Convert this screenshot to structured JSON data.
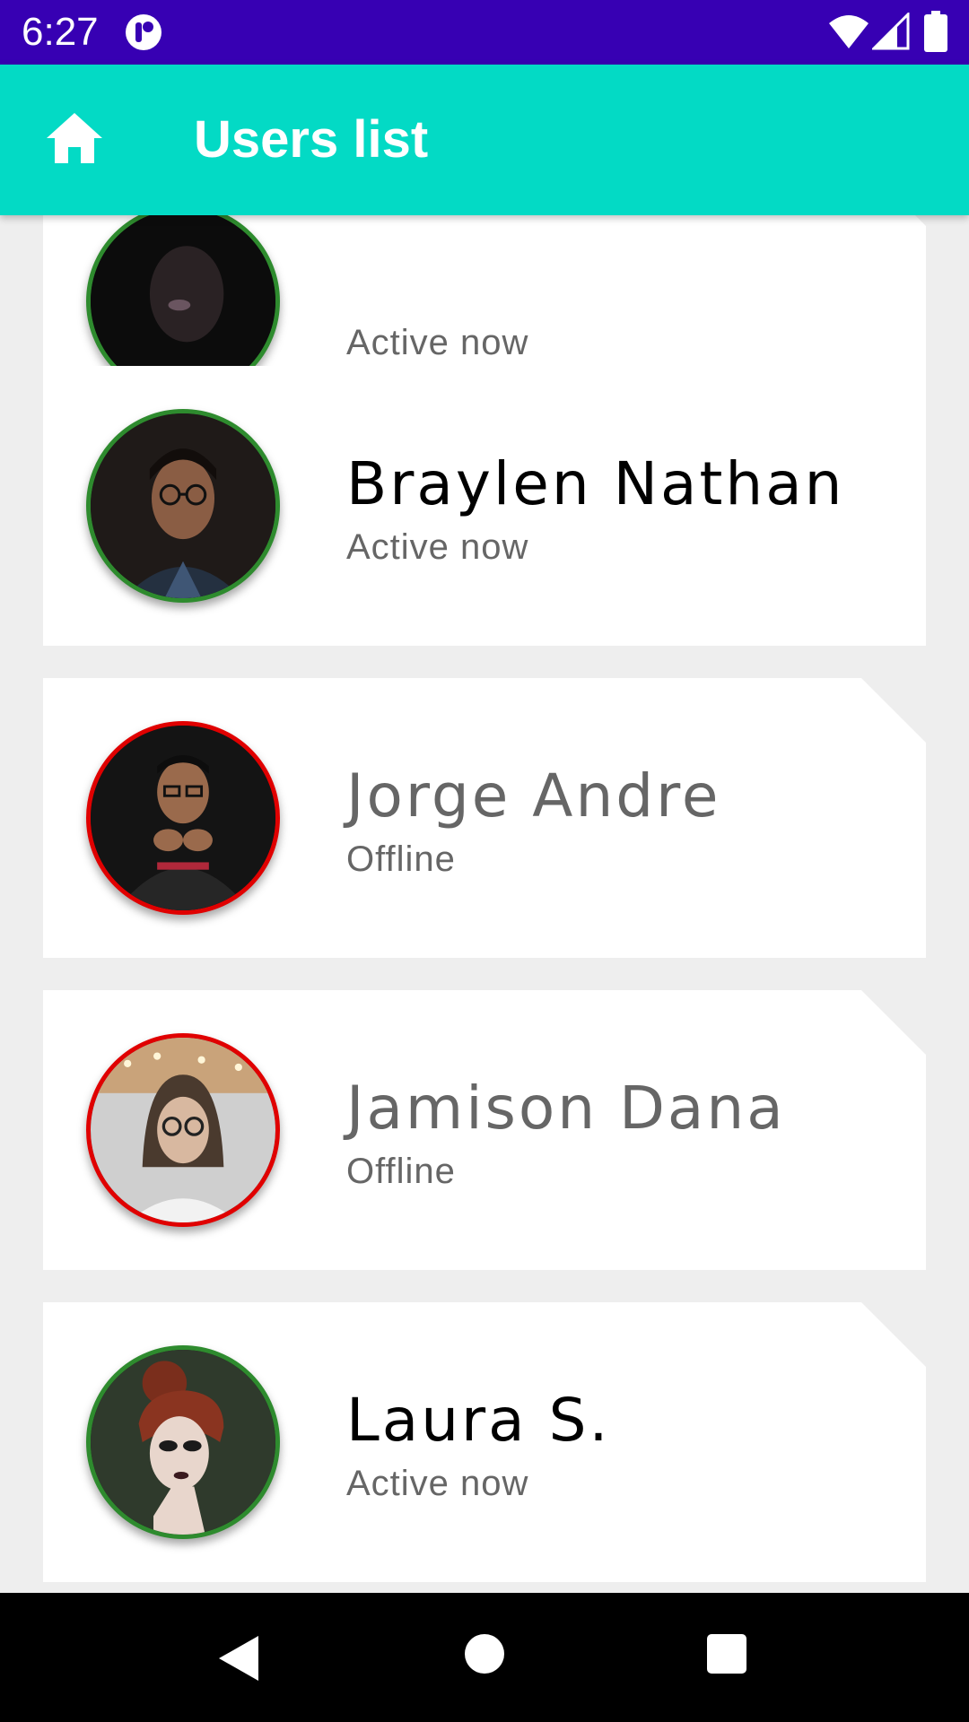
{
  "status_bar": {
    "time": "6:27",
    "icons": [
      "app-notification-icon",
      "wifi-icon",
      "signal-icon",
      "battery-icon"
    ]
  },
  "app_bar": {
    "title": "Users list",
    "icon": "home-icon",
    "background": "#03dac5"
  },
  "users": [
    {
      "name": "",
      "status": "Active now",
      "online": true
    },
    {
      "name": "Braylen Nathan",
      "status": "Active now",
      "online": true
    },
    {
      "name": "Jorge Andre",
      "status": "Offline",
      "online": false
    },
    {
      "name": "Jamison Dana",
      "status": "Offline",
      "online": false
    },
    {
      "name": "Laura S.",
      "status": "Active now",
      "online": true
    }
  ],
  "colors": {
    "status_bar": "#3700b3",
    "online_ring": "#2e8b2e",
    "offline_ring": "#e00000",
    "nav_bar": "#000000"
  },
  "nav_bar": {
    "buttons": [
      "back-icon",
      "home-circle-icon",
      "recents-square-icon"
    ]
  }
}
